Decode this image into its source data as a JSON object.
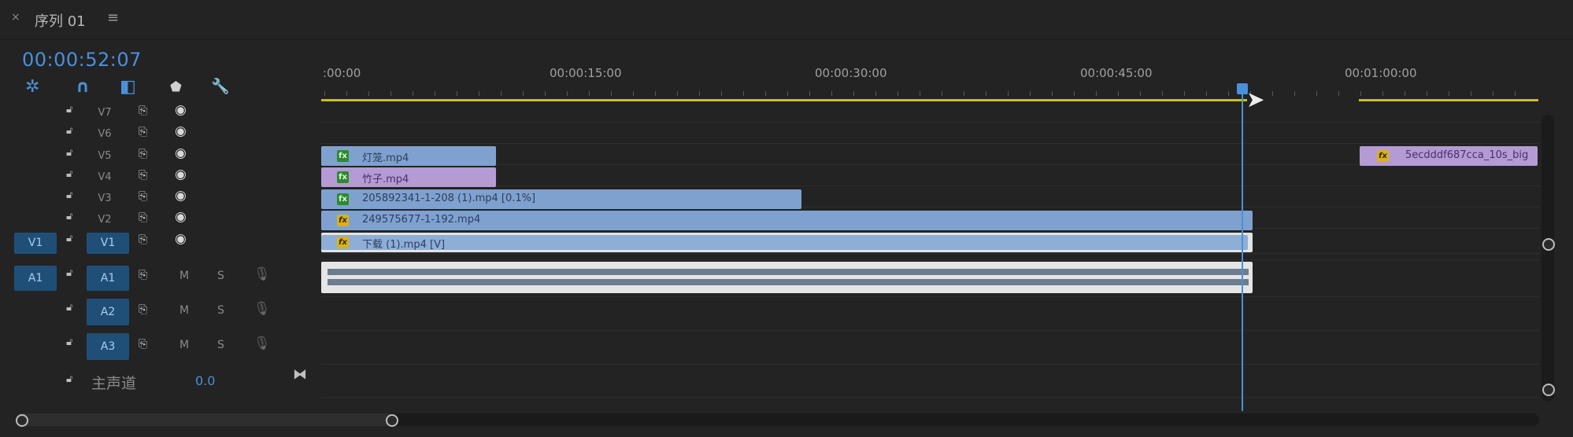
{
  "header": {
    "close_glyph": "×",
    "sequence_title": "序列 01",
    "menu_glyph": "≡",
    "timecode": "00:00:52:07"
  },
  "toolbar": {
    "tools": [
      {
        "name": "nest-icon",
        "glyph": "✲"
      },
      {
        "name": "snap-icon",
        "glyph": "∩"
      },
      {
        "name": "linked-selection-icon",
        "glyph": "◧"
      },
      {
        "name": "add-marker-icon",
        "glyph": "⬟"
      },
      {
        "name": "wrench-icon",
        "glyph": "🔧"
      }
    ]
  },
  "ruler": {
    "labels": [
      ":00:00",
      "00:00:15:00",
      "00:00:30:00",
      "00:00:45:00",
      "00:01:00:00"
    ]
  },
  "tracks": {
    "video": [
      {
        "name": "V7"
      },
      {
        "name": "V6"
      },
      {
        "name": "V5"
      },
      {
        "name": "V4"
      },
      {
        "name": "V3"
      },
      {
        "name": "V2"
      },
      {
        "name": "V1",
        "source": "V1"
      }
    ],
    "audio": [
      {
        "name": "A1",
        "source": "A1",
        "mute": "M",
        "solo": "S"
      },
      {
        "name": "A2",
        "mute": "M",
        "solo": "S"
      },
      {
        "name": "A3",
        "mute": "M",
        "solo": "S"
      }
    ]
  },
  "clips": {
    "v5": [
      {
        "label": "灯笼.mp4",
        "badge": "fx",
        "badge_type": "green"
      },
      {
        "label": "5ecdddf687cca_10s_big",
        "badge": "fx",
        "badge_type": "yellow"
      }
    ],
    "v4": {
      "label": "竹子.mp4",
      "badge": "fx",
      "badge_type": "green"
    },
    "v3": {
      "label": "205892341-1-208 (1).mp4 [0.1%]",
      "badge": "fx",
      "badge_type": "green"
    },
    "v2": {
      "label": "249575677-1-192.mp4",
      "badge": "fx",
      "badge_type": "yellow"
    },
    "v1": {
      "label": "下载 (1).mp4 [V]",
      "badge": "fx",
      "badge_type": "yellow"
    }
  },
  "master": {
    "label": "主声道",
    "value": "0.0"
  },
  "colors": {
    "accent": "#4a90d9",
    "work_area": "#c8c01a",
    "clip_blue": "#7fa1cf",
    "clip_purple": "#b49bd4"
  }
}
